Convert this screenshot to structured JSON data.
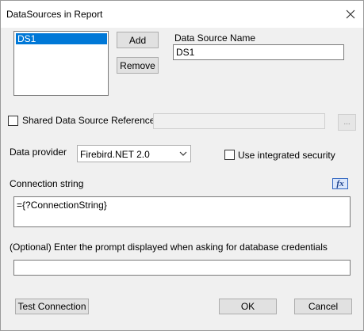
{
  "window": {
    "title": "DataSources in Report"
  },
  "datasources": {
    "items": [
      "DS1"
    ],
    "selected_index": 0
  },
  "buttons": {
    "add": "Add",
    "remove": "Remove",
    "ellipsis": "...",
    "test_connection": "Test Connection",
    "ok": "OK",
    "cancel": "Cancel"
  },
  "name_field": {
    "label": "Data Source Name",
    "value": "DS1"
  },
  "shared_reference": {
    "label": "Shared Data Source Reference",
    "checked": false,
    "value": ""
  },
  "provider": {
    "label": "Data provider",
    "selected": "Firebird.NET 2.0"
  },
  "integrated_security": {
    "label": "Use integrated security",
    "checked": false
  },
  "connection": {
    "label": "Connection string",
    "value": "={?ConnectionString}",
    "fx_label": "fx"
  },
  "prompt": {
    "label": "(Optional) Enter the prompt displayed when asking for database credentials",
    "value": ""
  }
}
